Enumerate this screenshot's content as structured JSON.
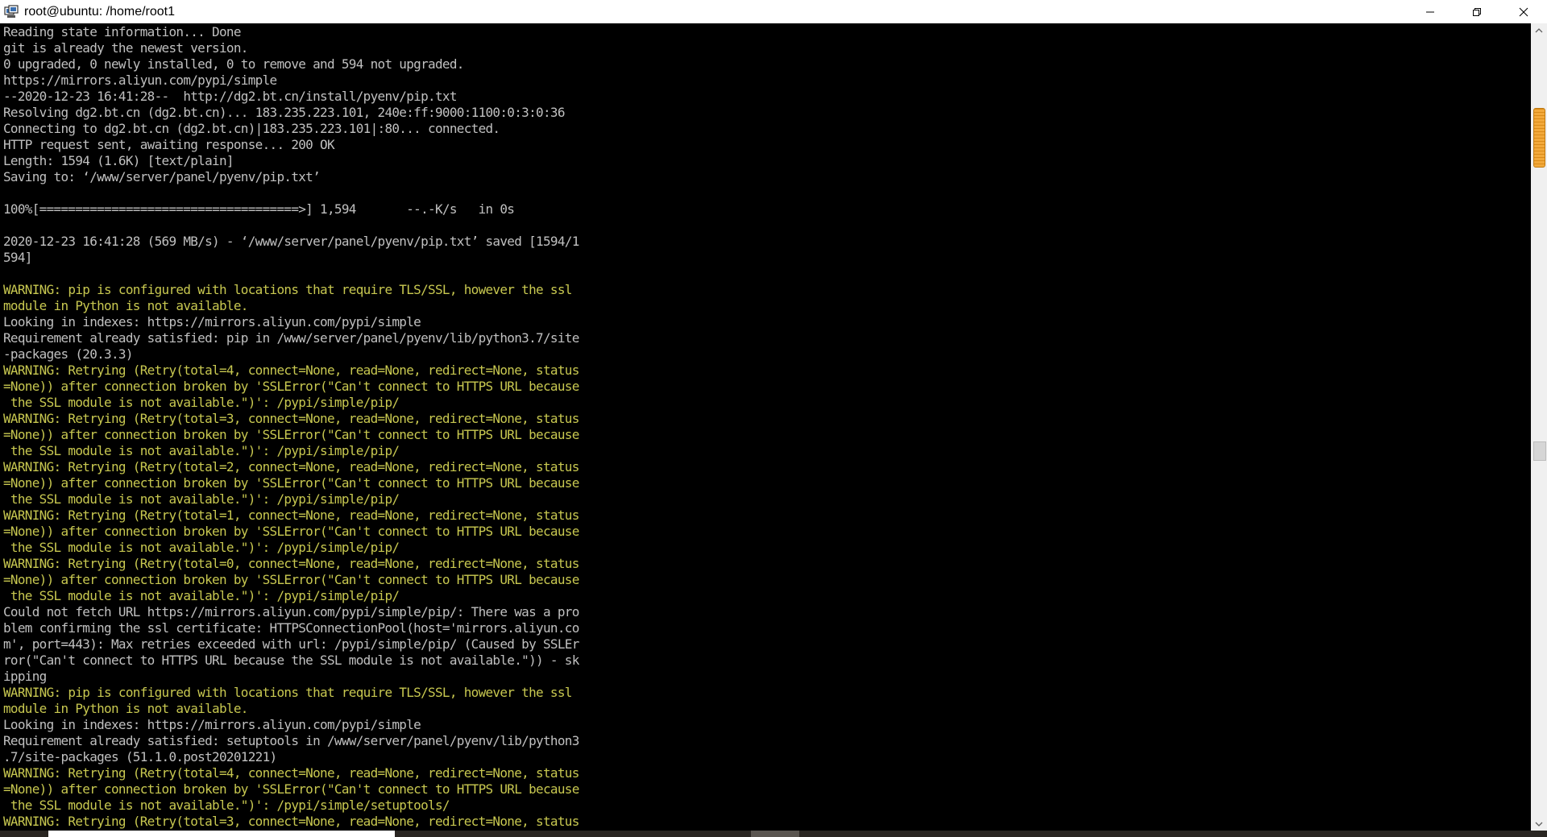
{
  "window": {
    "title": "root@ubuntu: /home/root1",
    "controls": [
      "minimize",
      "maximize",
      "close"
    ]
  },
  "colors": {
    "normal_text": "#c0c0c0",
    "warning_text": "#c8c850",
    "background": "#000000",
    "scroll_thumb": "#f2a93b"
  },
  "terminal": {
    "lines": [
      {
        "text": "Reading state information... Done",
        "style": "normal"
      },
      {
        "text": "git is already the newest version.",
        "style": "normal"
      },
      {
        "text": "0 upgraded, 0 newly installed, 0 to remove and 594 not upgraded.",
        "style": "normal"
      },
      {
        "text": "https://mirrors.aliyun.com/pypi/simple",
        "style": "normal"
      },
      {
        "text": "--2020-12-23 16:41:28--  http://dg2.bt.cn/install/pyenv/pip.txt",
        "style": "normal"
      },
      {
        "text": "Resolving dg2.bt.cn (dg2.bt.cn)... 183.235.223.101, 240e:ff:9000:1100:0:3:0:36",
        "style": "normal"
      },
      {
        "text": "Connecting to dg2.bt.cn (dg2.bt.cn)|183.235.223.101|:80... connected.",
        "style": "normal"
      },
      {
        "text": "HTTP request sent, awaiting response... 200 OK",
        "style": "normal"
      },
      {
        "text": "Length: 1594 (1.6K) [text/plain]",
        "style": "normal"
      },
      {
        "text": "Saving to: ‘/www/server/panel/pyenv/pip.txt’",
        "style": "normal"
      },
      {
        "text": "",
        "style": "normal"
      },
      {
        "text": "100%[====================================>] 1,594       --.-K/s   in 0s",
        "style": "normal"
      },
      {
        "text": "",
        "style": "normal"
      },
      {
        "text": "2020-12-23 16:41:28 (569 MB/s) - ‘/www/server/panel/pyenv/pip.txt’ saved [1594/1",
        "style": "normal"
      },
      {
        "text": "594]",
        "style": "normal"
      },
      {
        "text": "",
        "style": "normal"
      },
      {
        "text": "WARNING: pip is configured with locations that require TLS/SSL, however the ssl",
        "style": "warning"
      },
      {
        "text": "module in Python is not available.",
        "style": "warning"
      },
      {
        "text": "Looking in indexes: https://mirrors.aliyun.com/pypi/simple",
        "style": "normal"
      },
      {
        "text": "Requirement already satisfied: pip in /www/server/panel/pyenv/lib/python3.7/site",
        "style": "normal"
      },
      {
        "text": "-packages (20.3.3)",
        "style": "normal"
      },
      {
        "text": "WARNING: Retrying (Retry(total=4, connect=None, read=None, redirect=None, status",
        "style": "warning"
      },
      {
        "text": "=None)) after connection broken by 'SSLError(\"Can't connect to HTTPS URL because",
        "style": "warning"
      },
      {
        "text": " the SSL module is not available.\")': /pypi/simple/pip/",
        "style": "warning"
      },
      {
        "text": "WARNING: Retrying (Retry(total=3, connect=None, read=None, redirect=None, status",
        "style": "warning"
      },
      {
        "text": "=None)) after connection broken by 'SSLError(\"Can't connect to HTTPS URL because",
        "style": "warning"
      },
      {
        "text": " the SSL module is not available.\")': /pypi/simple/pip/",
        "style": "warning"
      },
      {
        "text": "WARNING: Retrying (Retry(total=2, connect=None, read=None, redirect=None, status",
        "style": "warning"
      },
      {
        "text": "=None)) after connection broken by 'SSLError(\"Can't connect to HTTPS URL because",
        "style": "warning"
      },
      {
        "text": " the SSL module is not available.\")': /pypi/simple/pip/",
        "style": "warning"
      },
      {
        "text": "WARNING: Retrying (Retry(total=1, connect=None, read=None, redirect=None, status",
        "style": "warning"
      },
      {
        "text": "=None)) after connection broken by 'SSLError(\"Can't connect to HTTPS URL because",
        "style": "warning"
      },
      {
        "text": " the SSL module is not available.\")': /pypi/simple/pip/",
        "style": "warning"
      },
      {
        "text": "WARNING: Retrying (Retry(total=0, connect=None, read=None, redirect=None, status",
        "style": "warning"
      },
      {
        "text": "=None)) after connection broken by 'SSLError(\"Can't connect to HTTPS URL because",
        "style": "warning"
      },
      {
        "text": " the SSL module is not available.\")': /pypi/simple/pip/",
        "style": "warning"
      },
      {
        "text": "Could not fetch URL https://mirrors.aliyun.com/pypi/simple/pip/: There was a pro",
        "style": "normal"
      },
      {
        "text": "blem confirming the ssl certificate: HTTPSConnectionPool(host='mirrors.aliyun.co",
        "style": "normal"
      },
      {
        "text": "m', port=443): Max retries exceeded with url: /pypi/simple/pip/ (Caused by SSLEr",
        "style": "normal"
      },
      {
        "text": "ror(\"Can't connect to HTTPS URL because the SSL module is not available.\")) - sk",
        "style": "normal"
      },
      {
        "text": "ipping",
        "style": "normal"
      },
      {
        "text": "WARNING: pip is configured with locations that require TLS/SSL, however the ssl",
        "style": "warning"
      },
      {
        "text": "module in Python is not available.",
        "style": "warning"
      },
      {
        "text": "Looking in indexes: https://mirrors.aliyun.com/pypi/simple",
        "style": "normal"
      },
      {
        "text": "Requirement already satisfied: setuptools in /www/server/panel/pyenv/lib/python3",
        "style": "normal"
      },
      {
        "text": ".7/site-packages (51.1.0.post20201221)",
        "style": "normal"
      },
      {
        "text": "WARNING: Retrying (Retry(total=4, connect=None, read=None, redirect=None, status",
        "style": "warning"
      },
      {
        "text": "=None)) after connection broken by 'SSLError(\"Can't connect to HTTPS URL because",
        "style": "warning"
      },
      {
        "text": " the SSL module is not available.\")': /pypi/simple/setuptools/",
        "style": "warning"
      },
      {
        "text": "WARNING: Retrying (Retry(total=3, connect=None, read=None, redirect=None, status",
        "style": "warning"
      }
    ]
  }
}
